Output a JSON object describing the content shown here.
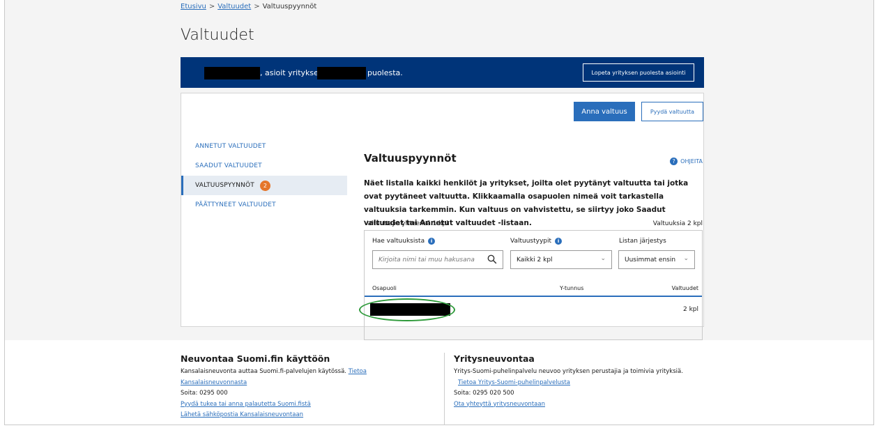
{
  "breadcrumb": {
    "items": [
      "Etusivu",
      "Valtuudet",
      "Valtuuspyynnöt"
    ],
    "separator": ">"
  },
  "page": {
    "title": "Valtuudet"
  },
  "banner": {
    "text_mid": ", asioit yrityksen",
    "text_end": "puolesta.",
    "stop_button": "Lopeta yrityksen puolesta asiointi"
  },
  "actions": {
    "give_button": "Anna valtuus",
    "request_button": "Pyydä valtuutta"
  },
  "sidebar": {
    "items": [
      {
        "label": "ANNETUT VALTUUDET"
      },
      {
        "label": "SAADUT VALTUUDET"
      },
      {
        "label": "VALTUUSPYYNNÖT",
        "badge": "2"
      },
      {
        "label": "PÄÄTTYNEET VALTUUDET"
      }
    ]
  },
  "main": {
    "heading": "Valtuuspyynnöt",
    "help_label": "OHJEITA",
    "description": "Näet listalla kaikki henkilöt ja yritykset, joilta olet pyytänyt valtuutta tai jotka ovat pyytäneet valtuutta. Klikkaamalla osapuolen nimeä voit tarkastella valtuuksia tarkemmin. Kun valtuus on vahvistettu, se siirtyy joko Saadut valtuudet tai Annetut valtuudet -listaan.",
    "summary_left": "Valtuuttajia yhteensä 1 kpl",
    "summary_right": "Valtuuksia 2 kpl",
    "filters": {
      "search_label": "Hae valtuuksista",
      "search_placeholder": "Kirjoita nimi tai muu hakusana",
      "types_label": "Valtuustyypit",
      "types_value": "Kaikki 2 kpl",
      "order_label": "Listan järjestys",
      "order_value": "Uusimmat ensin"
    },
    "table": {
      "headers": [
        "Osapuoli",
        "Y-tunnus",
        "Valtuudet"
      ],
      "rows": [
        {
          "count": "2 kpl"
        }
      ]
    }
  },
  "footer": {
    "left": {
      "title": "Neuvontaa Suomi.fin käyttöön",
      "text": "Kansalaisneuvonta auttaa Suomi.fi-palvelujen käytössä.",
      "link_info_1": "Tietoa",
      "link_info_2": "Kansalaisneuvonnasta",
      "phone": "Soita: 0295 000",
      "link_feedback": "Pyydä tukea tai anna palautetta Suomi.fistä",
      "link_email": "Lähetä sähköpostia Kansalaisneuvontaan"
    },
    "right": {
      "title": "Yritysneuvontaa",
      "text": "Yritys-Suomi-puhelinpalvelu neuvoo yrityksen perustajia ja toimivia yrityksiä.",
      "link_info": "Tietoa Yritys-Suomi-puhelinpalvelusta",
      "phone": "Soita: 0295 020 500",
      "link_contact": "Ota yhteyttä yritysneuvontaan"
    }
  },
  "colors": {
    "banner_bg": "#003479",
    "accent": "#2a6ebb",
    "badge": "#e5762b",
    "highlight_ellipse": "#2e9a3a"
  }
}
